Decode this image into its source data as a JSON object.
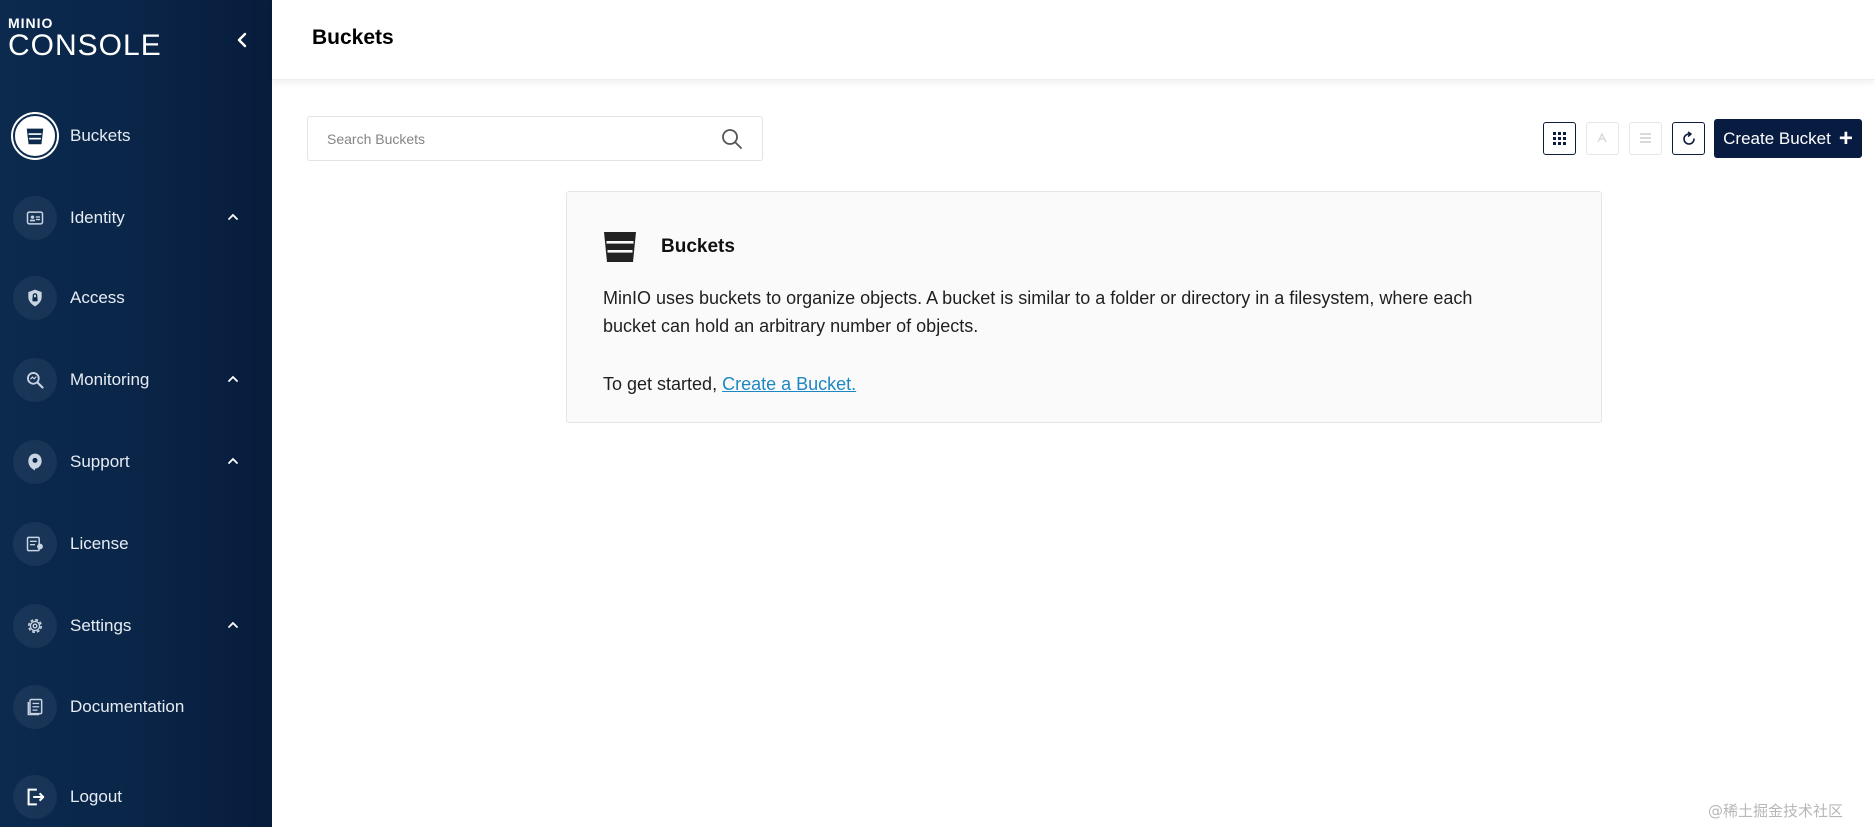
{
  "brand": {
    "small": "MINIO",
    "big": "CONSOLE"
  },
  "sidebar": {
    "items": [
      {
        "label": "Buckets",
        "icon": "bucket-icon",
        "active": true
      },
      {
        "label": "Identity",
        "icon": "id-card-icon",
        "expandable": true
      },
      {
        "label": "Access",
        "icon": "lock-shield-icon"
      },
      {
        "label": "Monitoring",
        "icon": "monitoring-search-icon",
        "expandable": true
      },
      {
        "label": "Support",
        "icon": "support-icon",
        "expandable": true
      },
      {
        "label": "License",
        "icon": "license-icon"
      },
      {
        "label": "Settings",
        "icon": "gear-icon",
        "expandable": true
      },
      {
        "label": "Documentation",
        "icon": "documentation-icon"
      },
      {
        "label": "Logout",
        "icon": "logout-icon"
      }
    ]
  },
  "header": {
    "title": "Buckets"
  },
  "search": {
    "placeholder": "Search Buckets",
    "value": ""
  },
  "toolbar": {
    "create_label": "Create Bucket"
  },
  "info": {
    "title": "Buckets",
    "description": "MinIO uses buckets to organize objects. A bucket is similar to a folder or directory in a filesystem, where each bucket can hold an arbitrary number of objects.",
    "cta_prefix": "To get started, ",
    "cta_link": "Create a Bucket."
  },
  "watermark": "@稀土掘金技术社区",
  "colors": {
    "sidebar_bg": "#0a2548",
    "primary_button": "#081c42",
    "link": "#1d87c2"
  }
}
